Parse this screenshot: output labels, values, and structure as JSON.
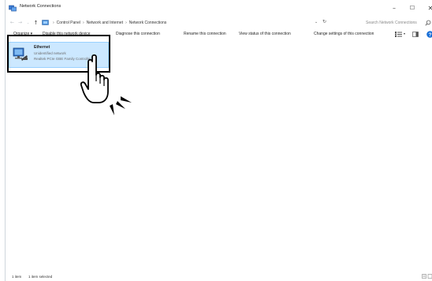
{
  "window": {
    "title": "Network Connections",
    "controls": {
      "minimize": "–",
      "maximize": "☐",
      "close": "✕"
    }
  },
  "addressbar": {
    "back": "←",
    "forward": "→",
    "recent": "⌄",
    "up": "↑",
    "breadcrumb": [
      "Control Panel",
      "Network and Internet",
      "Network Connections"
    ],
    "separator": "›",
    "dropdown": "⌄",
    "refresh": "↻",
    "search_placeholder": "Search Network Connections"
  },
  "commandbar": {
    "organize": "Organize ▾",
    "disable": "Disable this network device",
    "diagnose": "Diagnose this connection",
    "rename": "Rename this connection",
    "view_status": "View status of this connection",
    "change_settings": "Change settings of this connection",
    "view_caret": "▾"
  },
  "connection": {
    "name": "Ethernet",
    "status": "Unidentified network",
    "device": "Realtek PCIe GBE Family Controller"
  },
  "statusbar": {
    "item_count": "1 item",
    "selected": "1 item selected"
  },
  "colors": {
    "selection_fill": "#cce8ff",
    "selection_border": "#99d1ff",
    "highlight_border": "#000000"
  }
}
